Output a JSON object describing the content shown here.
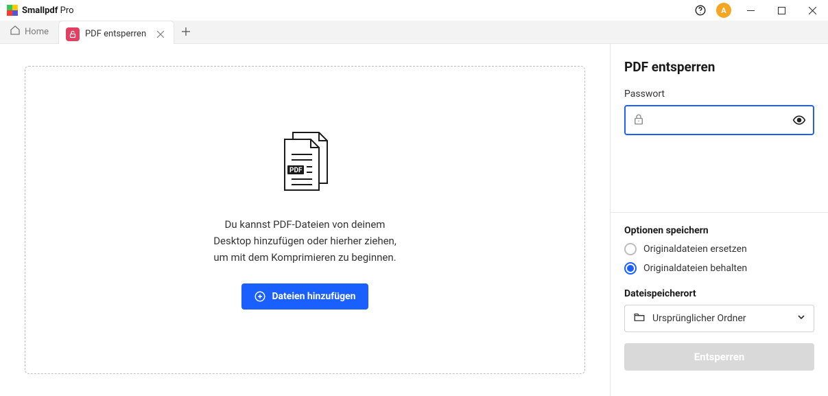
{
  "titlebar": {
    "app_name": "Smallpdf",
    "app_suffix": " Pro",
    "avatar_letter": "A"
  },
  "tabs": {
    "home_label": "Home",
    "active": {
      "label": "PDF entsperren"
    }
  },
  "dropzone": {
    "line1": "Du kannst PDF-Dateien von deinem",
    "line2": "Desktop hinzufügen oder hierher ziehen,",
    "line3": "um mit dem Komprimieren zu beginnen.",
    "add_button": "Dateien hinzufügen"
  },
  "sidebar": {
    "title": "PDF entsperren",
    "password_label": "Passwort",
    "password_value": "",
    "options_title": "Optionen speichern",
    "radio_replace": "Originaldateien ersetzen",
    "radio_keep": "Originaldateien behalten",
    "location_label": "Dateispeicherort",
    "location_value": "Ursprünglicher Ordner",
    "unlock_button": "Entsperren"
  }
}
